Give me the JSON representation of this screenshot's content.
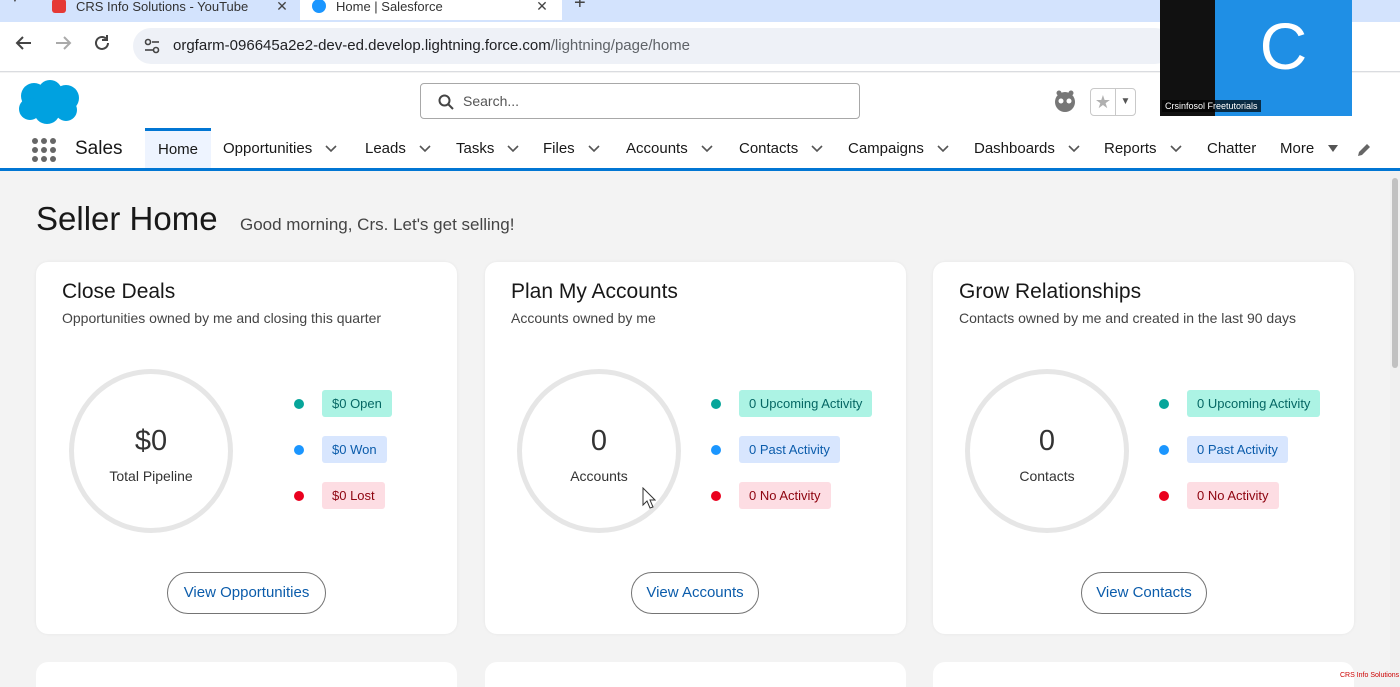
{
  "browser": {
    "tabs": [
      {
        "title": "CRS Info Solutions - YouTube"
      },
      {
        "title": "Home | Salesforce"
      }
    ],
    "url_domain": "orgfarm-096645a2e2-dev-ed.develop.lightning.force.com",
    "url_path": "/lightning/page/home",
    "new_tab_glyph": "+",
    "close_glyph": "✕"
  },
  "header": {
    "search_placeholder": "Search..."
  },
  "appnav": {
    "app_name": "Sales",
    "items": [
      {
        "label": "Home",
        "active": true
      },
      {
        "label": "Opportunities"
      },
      {
        "label": "Leads"
      },
      {
        "label": "Tasks"
      },
      {
        "label": "Files"
      },
      {
        "label": "Accounts"
      },
      {
        "label": "Contacts"
      },
      {
        "label": "Campaigns"
      },
      {
        "label": "Dashboards"
      },
      {
        "label": "Reports"
      },
      {
        "label": "Chatter"
      },
      {
        "label": "More"
      }
    ]
  },
  "page": {
    "title": "Seller Home",
    "greeting": "Good morning, Crs. Let's get selling!"
  },
  "cards": [
    {
      "title": "Close Deals",
      "subtitle": "Opportunities owned by me and closing this quarter",
      "ring_value": "$0",
      "ring_label": "Total Pipeline",
      "legend": [
        "$0 Open",
        "$0 Won",
        "$0 Lost"
      ],
      "button": "View Opportunities"
    },
    {
      "title": "Plan My Accounts",
      "subtitle": "Accounts owned by me",
      "ring_value": "0",
      "ring_label": "Accounts",
      "legend": [
        "0 Upcoming Activity",
        "0 Past Activity",
        "0 No Activity"
      ],
      "button": "View Accounts"
    },
    {
      "title": "Grow Relationships",
      "subtitle": "Contacts owned by me and created in the last 90 days",
      "ring_value": "0",
      "ring_label": "Contacts",
      "legend": [
        "0 Upcoming Activity",
        "0 Past Activity",
        "0 No Activity"
      ],
      "button": "View Contacts"
    }
  ],
  "colors": {
    "brand_blue": "#0176d3",
    "legend_green_dot": "#06a59a",
    "legend_green_pill": "#acf3e4",
    "legend_blue_dot": "#1b96ff",
    "legend_blue_pill": "#d8e6fe",
    "legend_red_dot": "#ea001e",
    "legend_red_pill": "#fddde3",
    "webcam_blue": "#1f8fe5"
  },
  "webcam": {
    "letter": "C",
    "name": "Crsinfosol Freetutorials"
  },
  "watermark": "CRS Info Solutions"
}
